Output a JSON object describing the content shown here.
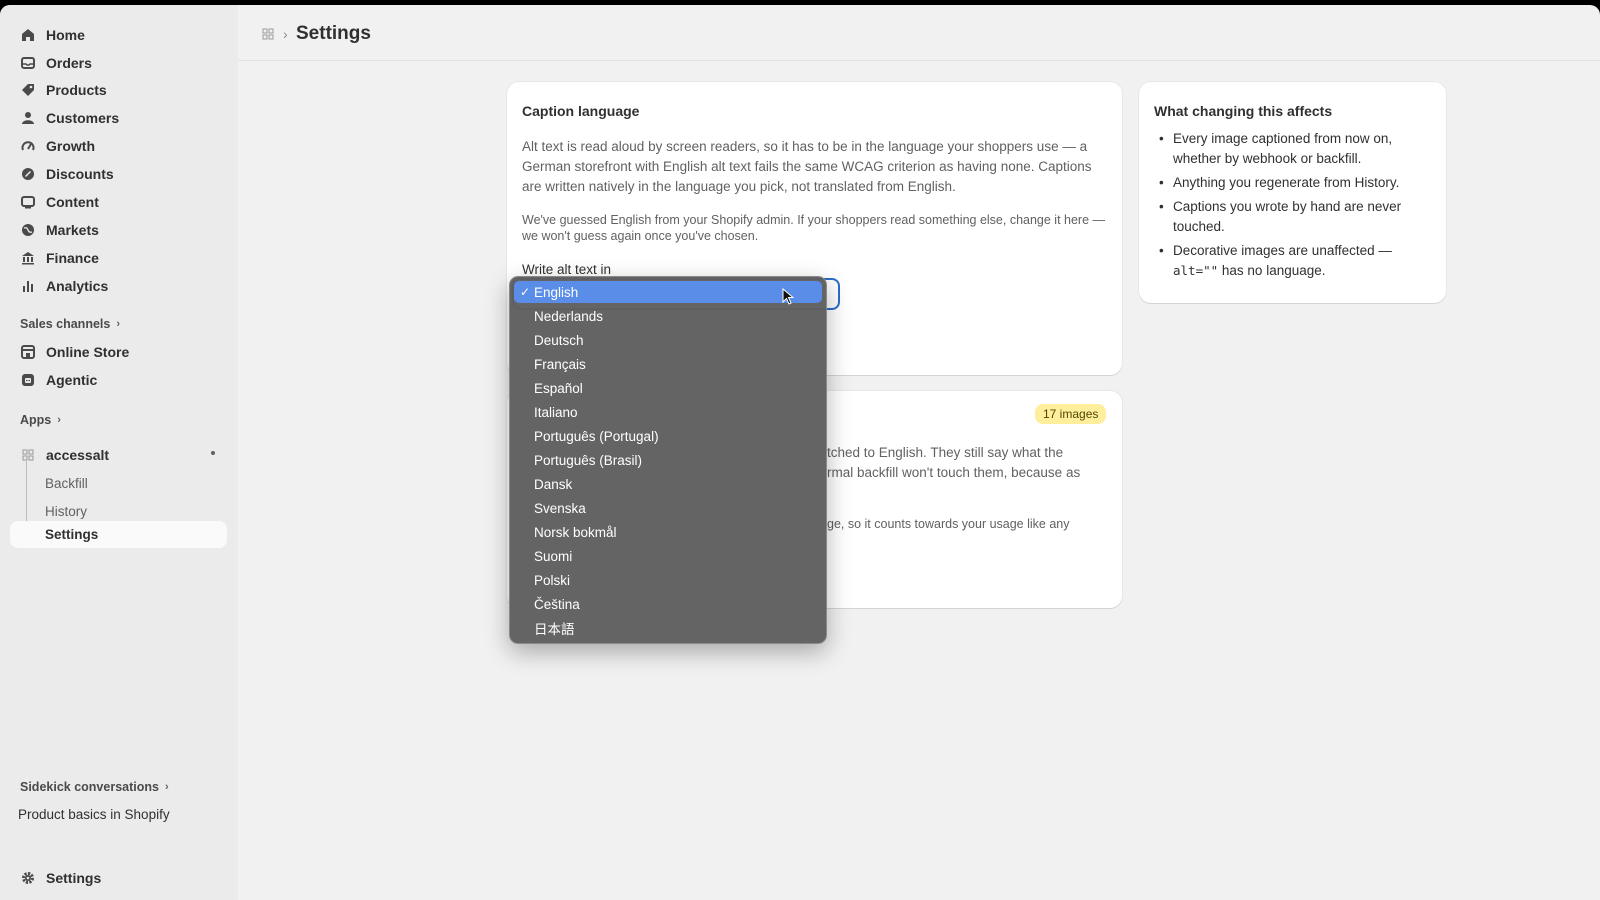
{
  "sidebar": {
    "nav": [
      {
        "label": "Home",
        "icon": "home-icon"
      },
      {
        "label": "Orders",
        "icon": "inbox-icon"
      },
      {
        "label": "Products",
        "icon": "tag-icon"
      },
      {
        "label": "Customers",
        "icon": "person-icon"
      },
      {
        "label": "Growth",
        "icon": "gauge-icon"
      },
      {
        "label": "Discounts",
        "icon": "discount-icon"
      },
      {
        "label": "Content",
        "icon": "content-icon"
      },
      {
        "label": "Markets",
        "icon": "globe-icon"
      },
      {
        "label": "Finance",
        "icon": "bank-icon"
      },
      {
        "label": "Analytics",
        "icon": "bar-chart-icon"
      }
    ],
    "sales_channels_header": "Sales channels",
    "channels": [
      {
        "label": "Online Store",
        "icon": "store-icon"
      },
      {
        "label": "Agentic",
        "icon": "agentic-icon"
      }
    ],
    "apps_header": "Apps",
    "app_name": "accessalt",
    "app_sub_items": [
      "Backfill",
      "History",
      "Settings"
    ],
    "sidekick_header": "Sidekick conversations",
    "sidekick_item": "Product basics in Shopify",
    "settings_label": "Settings"
  },
  "header": {
    "title": "Settings"
  },
  "caption_card": {
    "title": "Caption language",
    "description": "Alt text is read aloud by screen readers, so it has to be in the language your shoppers use — a German storefront with English alt text fails the same WCAG criterion as having none. Captions are written natively in the language you pick, not translated from English.",
    "note": "We've guessed English from your Shopify admin. If your shoppers read something else, change it here — we won't guess again once you've chosen.",
    "field_label": "Write alt text in",
    "selected_language": "English"
  },
  "second_card": {
    "badge": "17 images",
    "para_fragment_1": "tched to English. They still say what the",
    "para_fragment_2": "rmal backfill won't touch them, because as",
    "note_fragment": "ge, so it counts towards your usage like any"
  },
  "affects_card": {
    "title": "What changing this affects",
    "bullets": [
      "Every image captioned from now on, whether by webhook or backfill.",
      "Anything you regenerate from History.",
      "Captions you wrote by hand are never touched."
    ],
    "bullet_last_prefix": "Decorative images are unaffected — ",
    "bullet_last_code": "alt=\"\"",
    "bullet_last_suffix": " has no language."
  },
  "dropdown": {
    "options": [
      "English",
      "Nederlands",
      "Deutsch",
      "Français",
      "Español",
      "Italiano",
      "Português (Portugal)",
      "Português (Brasil)",
      "Dansk",
      "Svenska",
      "Norsk bokmål",
      "Suomi",
      "Polski",
      "Čeština",
      "日本語"
    ],
    "check": "✓"
  },
  "colors": {
    "accent": "#2c6ecb",
    "selected_option": "#5a8de8",
    "badge_bg": "#ffef9d"
  }
}
